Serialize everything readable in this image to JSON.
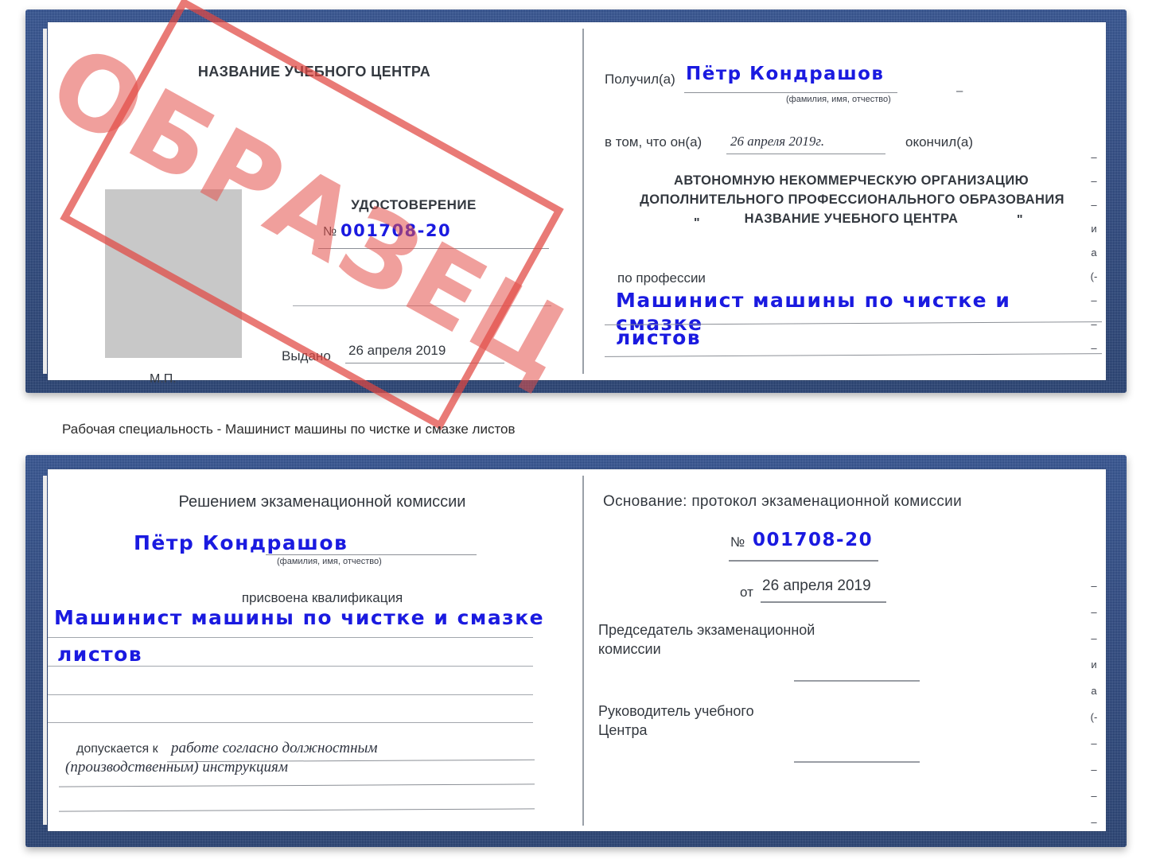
{
  "caption": "Рабочая специальность - Машинист машины по чистке и смазке листов",
  "watermark": {
    "text": "ОБРАЗЕЦ",
    "color": "#e4504b"
  },
  "colors": {
    "cover": "#27447f",
    "ink": "#1a1ae0",
    "paper": "#ffffff",
    "photo": "#c8c8c8",
    "rule": "#8b8f96"
  },
  "cert_top": {
    "left_page": {
      "org_title": "НАЗВАНИЕ УЧЕБНОГО ЦЕНТРА",
      "doc_type": "УДОСТОВЕРЕНИЕ",
      "number_label": "№",
      "number_value": "001708-20",
      "issued_label": "Выдано",
      "issued_value": "26 апреля 2019",
      "stamp_label": "М.П.",
      "photo_placeholder": "photo-box"
    },
    "right_page": {
      "received_label": "Получил(а)",
      "received_value": "Пётр Кондрашов",
      "fio_hint": "(фамилия, имя, отчество)",
      "in_that_label": "в том, что он(а)",
      "in_that_value": "26 апреля 2019г.",
      "finished_label": "окончил(а)",
      "org_line1": "АВТОНОМНУЮ НЕКОММЕРЧЕСКУЮ ОРГАНИЗАЦИЮ",
      "org_line2": "ДОПОЛНИТЕЛЬНОГО ПРОФЕССИОНАЛЬНОГО ОБРАЗОВАНИЯ",
      "org_quote_open": "\"",
      "org_line3": "НАЗВАНИЕ УЧЕБНОГО ЦЕНТРА",
      "org_quote_close": "\"",
      "profession_label": "по профессии",
      "profession_value_line1": "Машинист машины по чистке и смазке",
      "profession_value_line2": "листов",
      "edge_fragments": [
        "–",
        "–",
        "–",
        "и",
        "а",
        "(-",
        "–",
        "–",
        "–"
      ]
    }
  },
  "cert_bottom": {
    "left_page": {
      "decision_title": "Решением экзаменационной комиссии",
      "name_value": "Пётр Кондрашов",
      "fio_hint": "(фамилия, имя, отчество)",
      "qualification_label": "присвоена квалификация",
      "qualification_line1": "Машинист машины по чистке и смазке",
      "qualification_line2": "листов",
      "admitted_label": "допускается к",
      "admitted_value_line1": "работе согласно должностным",
      "admitted_value_line2": "(производственным) инструкциям"
    },
    "right_page": {
      "basis_label": "Основание: протокол экзаменационной комиссии",
      "number_label": "№",
      "number_value": "001708-20",
      "date_label": "от",
      "date_value": "26 апреля 2019",
      "chairman_line1": "Председатель экзаменационной",
      "chairman_line2": "комиссии",
      "head_line1": "Руководитель учебного",
      "head_line2": "Центра",
      "edge_fragments": [
        "–",
        "–",
        "–",
        "и",
        "а",
        "(-",
        "–",
        "–",
        "–",
        "–"
      ]
    }
  }
}
